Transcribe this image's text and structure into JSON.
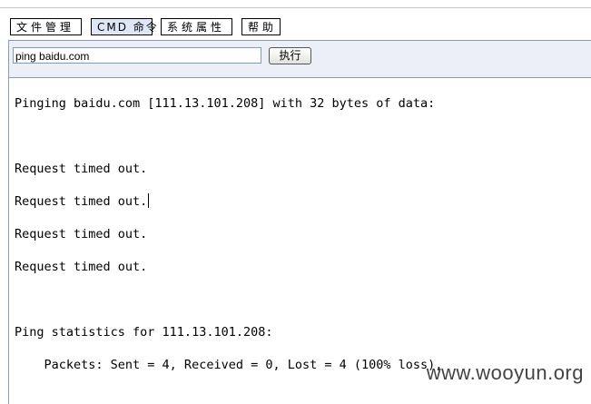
{
  "tabs": [
    {
      "id": "file",
      "label": "文件管理"
    },
    {
      "id": "cmd",
      "label": "CMD 命令"
    },
    {
      "id": "sys",
      "label": "系统属性"
    },
    {
      "id": "help",
      "label": "帮助"
    }
  ],
  "command": {
    "value": "ping baidu.com",
    "execute_label": "执行"
  },
  "output": {
    "lines": [
      "Pinging baidu.com [111.13.101.208] with 32 bytes of data:",
      "Request timed out.",
      "Request timed out.",
      "Request timed out.",
      "Request timed out.",
      "Ping statistics for 111.13.101.208:",
      "    Packets: Sent = 4, Received = 0, Lost = 4 (100% loss),"
    ]
  },
  "watermark": "www.wooyun.org"
}
